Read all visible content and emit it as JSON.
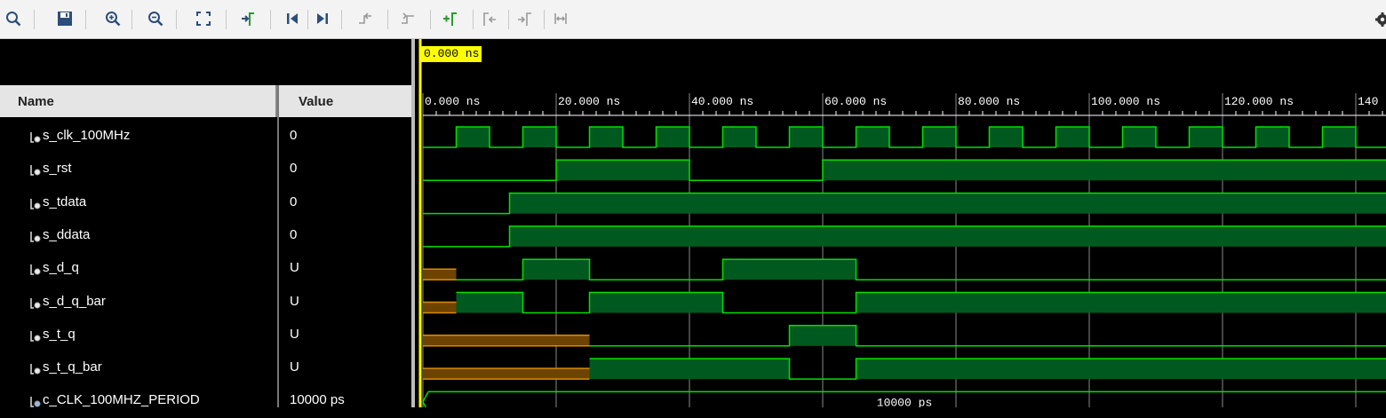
{
  "toolbar": {
    "buttons": [
      {
        "name": "zoom-fit-search-icon"
      },
      {
        "name": "save-icon"
      },
      {
        "name": "zoom-in-icon"
      },
      {
        "name": "zoom-out-icon"
      },
      {
        "name": "zoom-full-icon"
      },
      {
        "name": "go-to-cursor-icon"
      },
      {
        "name": "go-to-time-zero-icon"
      },
      {
        "name": "go-to-last-time-icon"
      },
      {
        "name": "previous-transition-icon"
      },
      {
        "name": "next-transition-icon"
      },
      {
        "name": "add-marker-icon"
      },
      {
        "name": "previous-marker-icon"
      },
      {
        "name": "next-marker-icon"
      },
      {
        "name": "swap-cursors-icon"
      }
    ],
    "settings_icon": "gear-icon"
  },
  "columns": {
    "name_header": "Name",
    "value_header": "Value"
  },
  "cursor": {
    "time_label": "0.000 ns",
    "time_ns": 0
  },
  "timeline": {
    "start_ns": 0,
    "end_ns": 143.2,
    "major_step_ns": 20,
    "minor_per_major": 10,
    "tick_labels": [
      "0.000 ns",
      "20.000 ns",
      "40.000 ns",
      "60.000 ns",
      "80.000 ns",
      "100.000 ns",
      "120.000 ns",
      "140"
    ]
  },
  "signals": [
    {
      "name": "s_clk_100MHz",
      "value": "0",
      "icon": "bit-signal-icon",
      "kind": "clock",
      "period_ns": 10,
      "start_level": 0,
      "high_first_ns": 5
    },
    {
      "name": "s_rst",
      "value": "0",
      "icon": "bit-signal-icon",
      "kind": "bit",
      "segments": [
        [
          0,
          0
        ],
        [
          20,
          1
        ],
        [
          40,
          0
        ],
        [
          60,
          1
        ]
      ]
    },
    {
      "name": "s_tdata",
      "value": "0",
      "icon": "bit-signal-icon",
      "kind": "bit",
      "segments": [
        [
          0,
          0
        ],
        [
          13,
          1
        ]
      ]
    },
    {
      "name": "s_ddata",
      "value": "0",
      "icon": "bit-signal-icon",
      "kind": "bit",
      "segments": [
        [
          0,
          0
        ],
        [
          13,
          1
        ]
      ]
    },
    {
      "name": "s_d_q",
      "value": "U",
      "icon": "bit-signal-icon",
      "kind": "bit",
      "segments": [
        [
          0,
          "U"
        ],
        [
          5,
          0
        ],
        [
          15,
          1
        ],
        [
          25,
          0
        ],
        [
          45,
          1
        ],
        [
          65,
          0
        ]
      ]
    },
    {
      "name": "s_d_q_bar",
      "value": "U",
      "icon": "bit-signal-icon",
      "kind": "bit",
      "segments": [
        [
          0,
          "U"
        ],
        [
          5,
          1
        ],
        [
          15,
          0
        ],
        [
          25,
          1
        ],
        [
          45,
          0
        ],
        [
          65,
          1
        ]
      ]
    },
    {
      "name": "s_t_q",
      "value": "U",
      "icon": "bit-signal-icon",
      "kind": "bit",
      "segments": [
        [
          0,
          "U"
        ],
        [
          25,
          0
        ],
        [
          55,
          1
        ],
        [
          65,
          0
        ]
      ]
    },
    {
      "name": "s_t_q_bar",
      "value": "U",
      "icon": "bit-signal-icon",
      "kind": "bit",
      "segments": [
        [
          0,
          "U"
        ],
        [
          25,
          1
        ],
        [
          55,
          0
        ],
        [
          65,
          1
        ]
      ]
    },
    {
      "name": "c_CLK_100MHZ_PERIOD",
      "value": "10000 ps",
      "icon": "constant-signal-icon",
      "kind": "bus",
      "bus_label": "10000 ps"
    }
  ],
  "colors": {
    "wave_green": "#00e000",
    "wave_fill": "#00591e",
    "undefined_orange": "#d98c00",
    "undefined_fill": "#6e4300",
    "cursor_yellow": "#ffff00",
    "grid": "#8a8a8a"
  }
}
